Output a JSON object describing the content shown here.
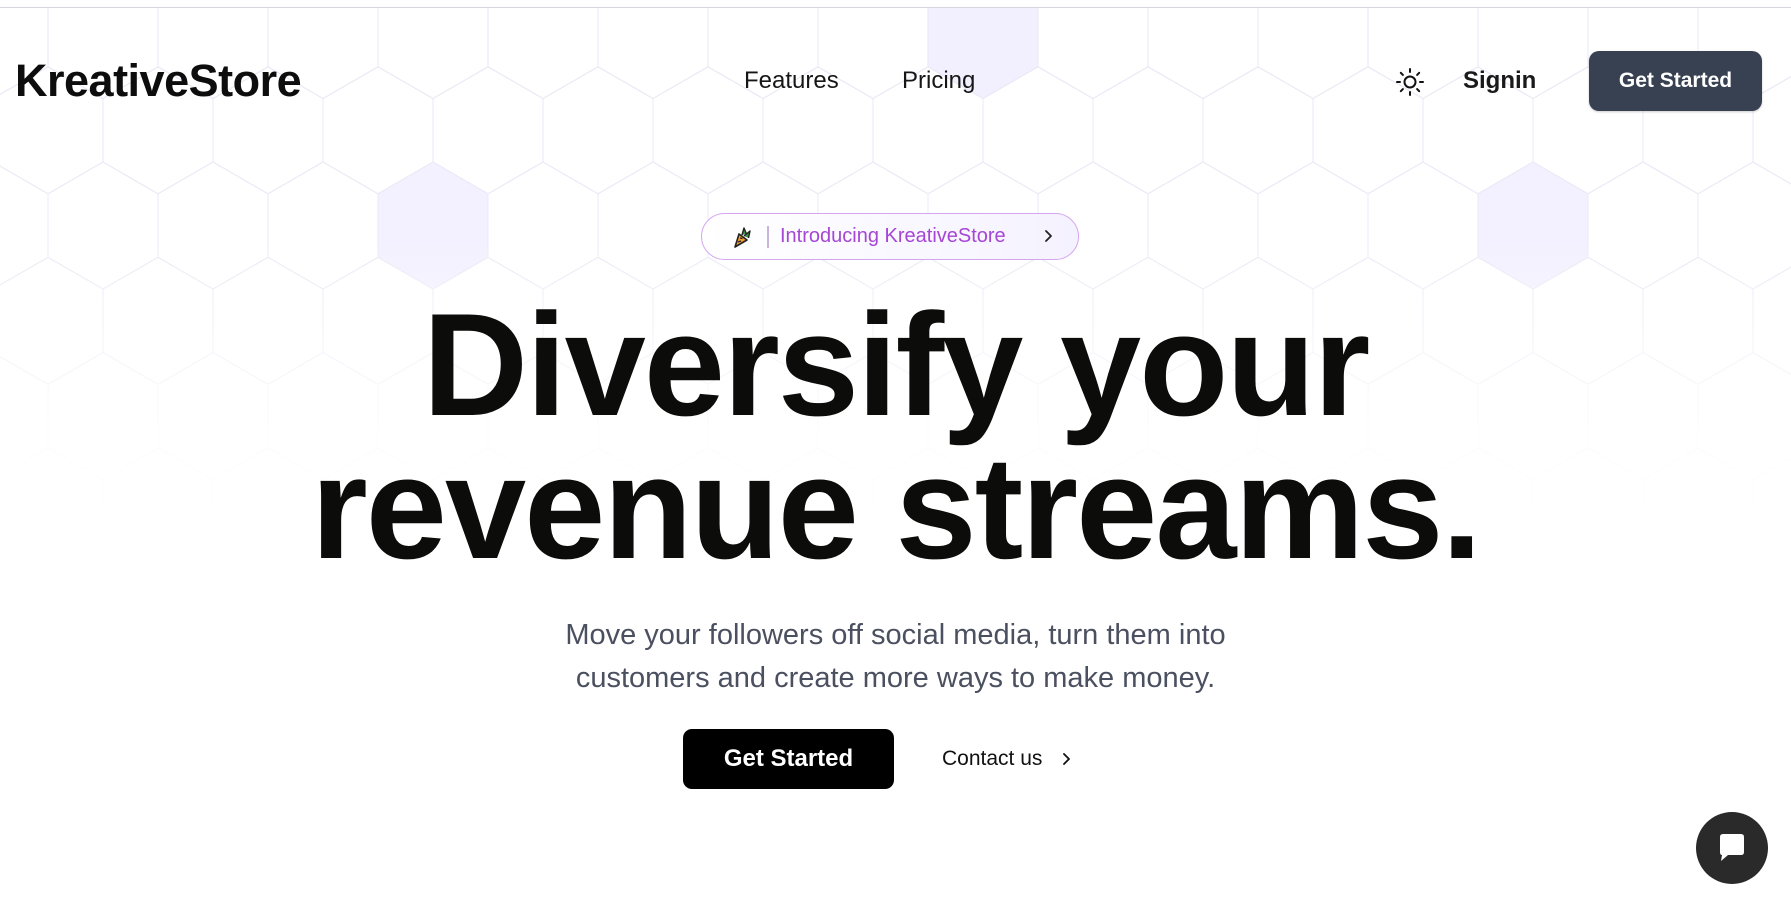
{
  "header": {
    "brand": "KreativeStore",
    "nav": [
      {
        "label": "Features"
      },
      {
        "label": "Pricing"
      }
    ],
    "theme_icon": "sun-icon",
    "signin_label": "Signin",
    "cta_label": "Get Started"
  },
  "badge": {
    "icon": "carrot-icon",
    "text": "Introducing KreativeStore",
    "chevron": "chevron-right-icon"
  },
  "hero": {
    "title": "Diversify your revenue streams.",
    "subtitle_line1": "Move your followers off social media, turn them into",
    "subtitle_line2": "customers and create more ways to make money.",
    "cta_label": "Get Started",
    "contact_label": "Contact us"
  },
  "chat": {
    "icon": "chat-bubble-icon"
  },
  "colors": {
    "header_cta_bg": "#374151",
    "hero_cta_bg": "#000000",
    "badge_text": "#a546d4",
    "badge_border": "#d5a6f0",
    "subtitle_text": "#4b5060",
    "hex_grid_stroke": "#e7e8f4",
    "hex_highlight_fill": "#f2efff"
  }
}
